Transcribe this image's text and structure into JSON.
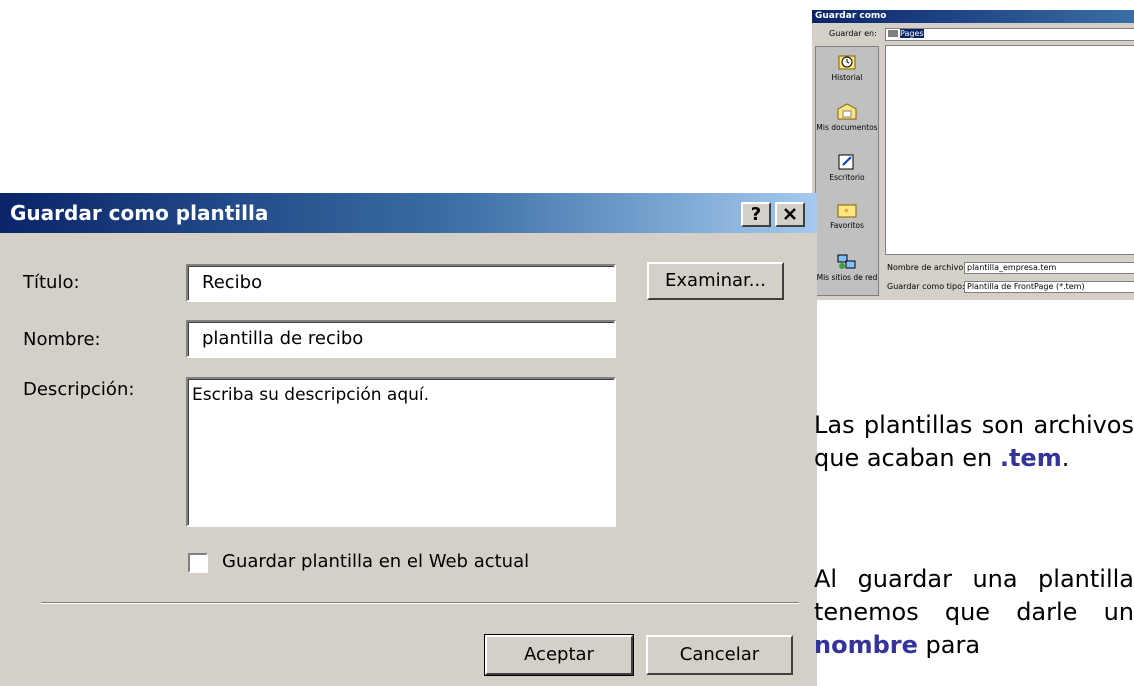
{
  "dialog": {
    "title": "Guardar como plantilla",
    "help_label": "?",
    "close_label": "✕",
    "titulo_label": "Título:",
    "titulo_value": "Recibo",
    "nombre_label": "Nombre:",
    "nombre_value": "plantilla de recibo",
    "descripcion_label": "Descripción:",
    "descripcion_value": "Escriba su descripción aquí.",
    "examinar_label": "Examinar...",
    "checkbox_label": "Guardar plantilla en el Web actual",
    "aceptar_label": "Aceptar",
    "cancelar_label": "Cancelar"
  },
  "save_dialog": {
    "title": "Guardar como",
    "guardar_en_label": "Guardar en:",
    "guardar_en_value": "Pages",
    "places": [
      "Historial",
      "Mis documentos",
      "Escritorio",
      "Favoritos",
      "Mis sitios de red"
    ],
    "nombre_archivo_label": "Nombre de archivo:",
    "nombre_archivo_value": "plantilla_empresa.tem",
    "tipo_label": "Guardar como tipo:",
    "tipo_value": "Plantilla de FrontPage (*.tem)"
  },
  "text": {
    "p1_a": "Las plantillas son archivos que acaban en ",
    "p1_b": ".tem",
    "p1_c": ".",
    "p2_a": "Al guardar una plantilla tenemos que darle un ",
    "p2_b": "nombre",
    "p2_c": " para"
  },
  "colors": {
    "titlebar_start": "#0a246a",
    "titlebar_end": "#a6caf0",
    "dialog_bg": "#d4d0c8",
    "highlight": "#333399"
  }
}
